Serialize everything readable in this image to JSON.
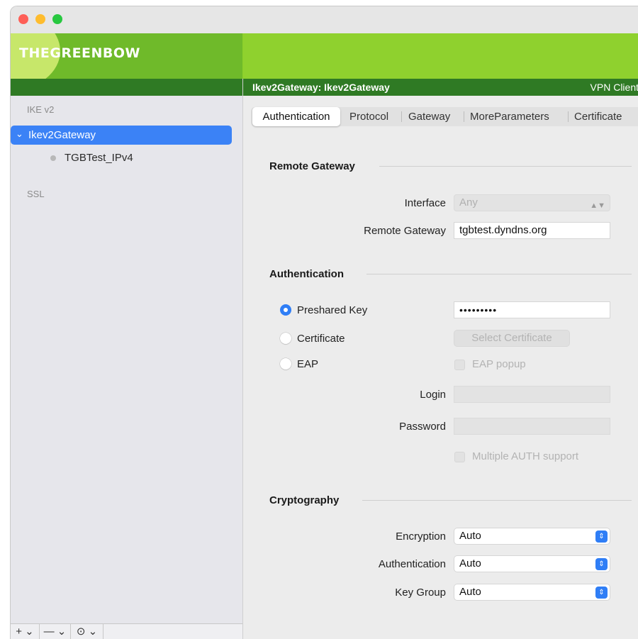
{
  "app": {
    "logo_text": "THEGREENBOW",
    "header_left": "Ikev2Gateway: Ikev2Gateway",
    "header_right": "VPN Client"
  },
  "sidebar": {
    "sections": {
      "ikev2": "IKE v2",
      "ssl": "SSL"
    },
    "tree": {
      "gateway": {
        "label": "Ikev2Gateway",
        "chevron": "chevron-down-icon"
      },
      "child": {
        "label": "TGBTest_IPv4"
      }
    },
    "toolbar": {
      "add": "+ ⌄",
      "remove": "— ⌄",
      "more": "⊙ ⌄"
    }
  },
  "tabs": [
    "Authentication",
    "Protocol",
    "Gateway",
    "MoreParameters",
    "Certificate"
  ],
  "remote_gateway": {
    "title": "Remote Gateway",
    "interface_label": "Interface",
    "interface_value": "Any",
    "gateway_label": "Remote Gateway",
    "gateway_value": "tgbtest.dyndns.org"
  },
  "authentication": {
    "title": "Authentication",
    "preshared_label": "Preshared Key",
    "preshared_value": "•••••••••",
    "certificate_label": "Certificate",
    "select_certificate": "Select Certificate",
    "eap_label": "EAP",
    "eap_popup": "EAP popup",
    "login_label": "Login",
    "login_value": "",
    "password_label": "Password",
    "password_value": "",
    "multiple_auth": "Multiple AUTH support"
  },
  "cryptography": {
    "title": "Cryptography",
    "encryption_label": "Encryption",
    "encryption_value": "Auto",
    "authentication_label": "Authentication",
    "authentication_value": "Auto",
    "keygroup_label": "Key Group",
    "keygroup_value": "Auto"
  },
  "colors": {
    "accent": "#2f7ef6",
    "banner_green": "#8ccf2a",
    "strip_green": "#2f7a24",
    "selection_blue": "#3b82f6"
  }
}
